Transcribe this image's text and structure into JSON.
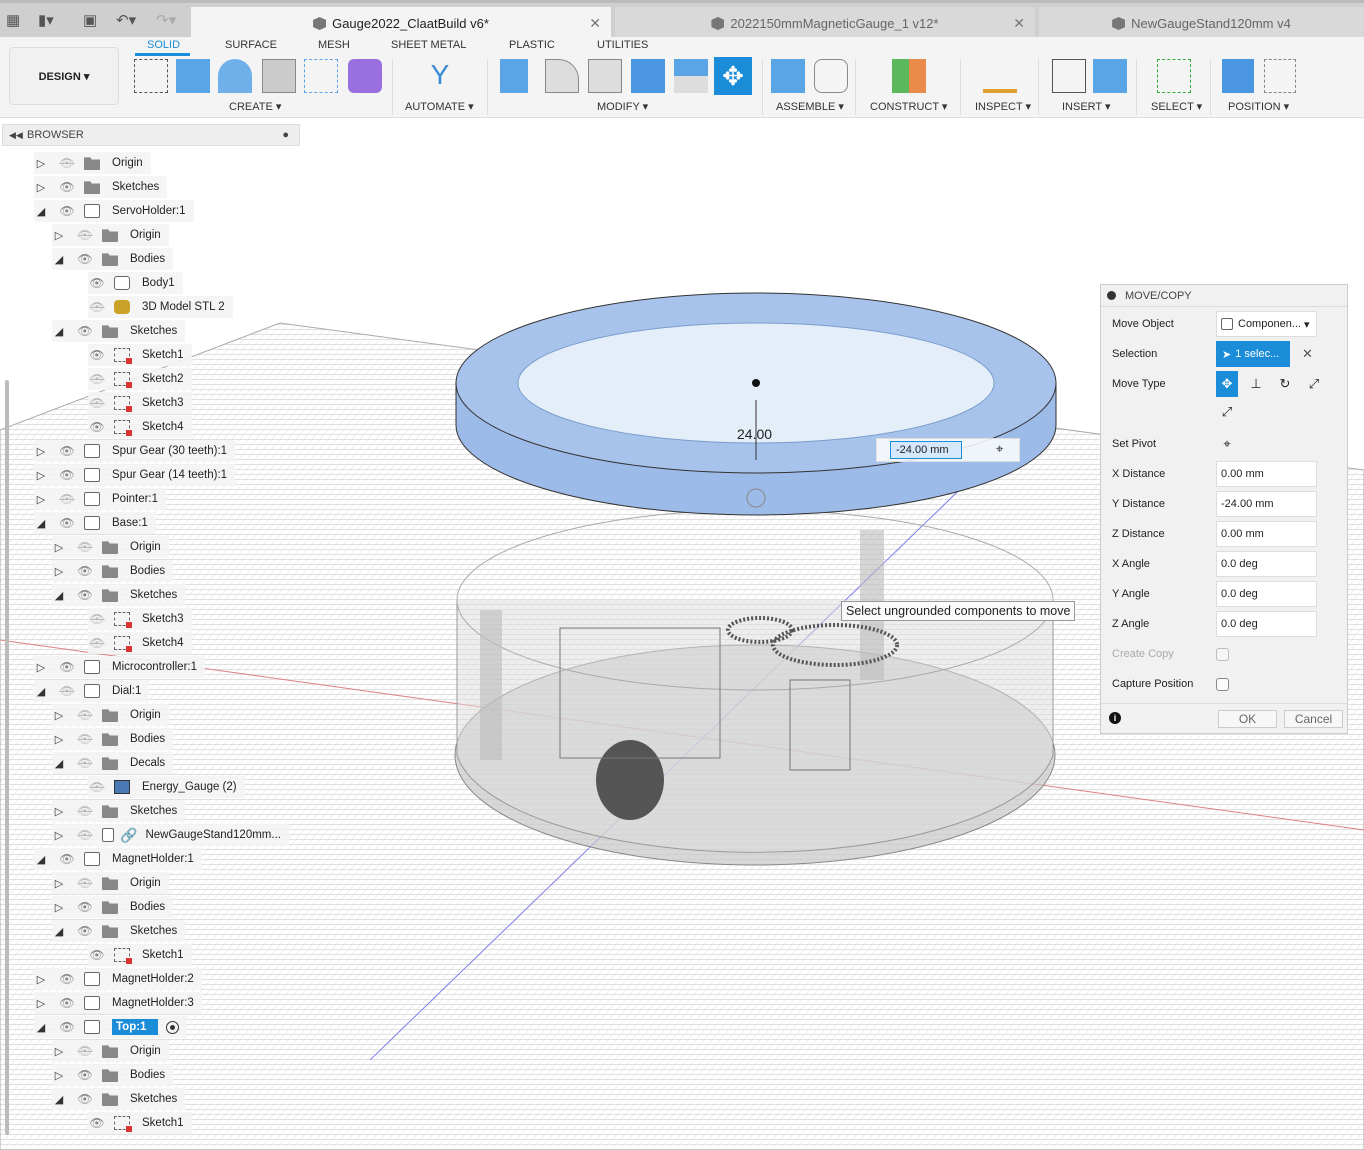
{
  "tabs": [
    {
      "title": "Gauge2022_ClaatBuild v6*",
      "active": true
    },
    {
      "title": "2022150mmMagneticGauge_1 v12*",
      "active": false
    },
    {
      "title": "NewGaugeStand120mm v4",
      "active": false
    }
  ],
  "toolbar_icons": [
    "grid-icon",
    "file-icon",
    "save-icon",
    "undo-icon",
    "redo-icon"
  ],
  "ribbon": {
    "workspace": "DESIGN ▾",
    "tabs": [
      "SOLID",
      "SURFACE",
      "MESH",
      "SHEET METAL",
      "PLASTIC",
      "UTILITIES"
    ],
    "active_tab": "SOLID",
    "groups": [
      "CREATE ▾",
      "AUTOMATE ▾",
      "MODIFY ▾",
      "ASSEMBLE ▾",
      "CONSTRUCT ▾",
      "INSPECT ▾",
      "INSERT ▾",
      "SELECT ▾",
      "POSITION ▾"
    ]
  },
  "browser": {
    "title": "BROWSER",
    "items": [
      {
        "label": "Origin",
        "level": 0,
        "state": "collapsed",
        "visible": false,
        "icon": "folder"
      },
      {
        "label": "Sketches",
        "level": 0,
        "state": "collapsed",
        "visible": true,
        "icon": "folder"
      },
      {
        "label": "ServoHolder:1",
        "level": 0,
        "state": "expanded",
        "visible": true,
        "icon": "component"
      },
      {
        "label": "Origin",
        "level": 1,
        "state": "collapsed",
        "visible": false,
        "icon": "folder"
      },
      {
        "label": "Bodies",
        "level": 1,
        "state": "expanded",
        "visible": true,
        "icon": "folder"
      },
      {
        "label": "Body1",
        "level": 2,
        "state": "none",
        "visible": true,
        "icon": "body"
      },
      {
        "label": "3D Model STL 2",
        "level": 2,
        "state": "none",
        "visible": false,
        "icon": "mesh"
      },
      {
        "label": "Sketches",
        "level": 1,
        "state": "expanded",
        "visible": true,
        "icon": "folder"
      },
      {
        "label": "Sketch1",
        "level": 2,
        "state": "none",
        "visible": true,
        "icon": "sketch"
      },
      {
        "label": "Sketch2",
        "level": 2,
        "state": "none",
        "visible": false,
        "icon": "sketch"
      },
      {
        "label": "Sketch3",
        "level": 2,
        "state": "none",
        "visible": false,
        "icon": "sketch"
      },
      {
        "label": "Sketch4",
        "level": 2,
        "state": "none",
        "visible": true,
        "icon": "sketch"
      },
      {
        "label": "Spur Gear (30 teeth):1",
        "level": 0,
        "state": "collapsed",
        "visible": true,
        "icon": "component"
      },
      {
        "label": "Spur Gear (14 teeth):1",
        "level": 0,
        "state": "collapsed",
        "visible": true,
        "icon": "component"
      },
      {
        "label": "Pointer:1",
        "level": 0,
        "state": "collapsed",
        "visible": false,
        "icon": "component"
      },
      {
        "label": "Base:1",
        "level": 0,
        "state": "expanded",
        "visible": true,
        "icon": "component"
      },
      {
        "label": "Origin",
        "level": 1,
        "state": "collapsed",
        "visible": false,
        "icon": "folder"
      },
      {
        "label": "Bodies",
        "level": 1,
        "state": "collapsed",
        "visible": true,
        "icon": "folder"
      },
      {
        "label": "Sketches",
        "level": 1,
        "state": "expanded",
        "visible": true,
        "icon": "folder"
      },
      {
        "label": "Sketch3",
        "level": 2,
        "state": "none",
        "visible": false,
        "icon": "sketch"
      },
      {
        "label": "Sketch4",
        "level": 2,
        "state": "none",
        "visible": false,
        "icon": "sketch"
      },
      {
        "label": "Microcontroller:1",
        "level": 0,
        "state": "collapsed",
        "visible": true,
        "icon": "component"
      },
      {
        "label": "Dial:1",
        "level": 0,
        "state": "expanded",
        "visible": false,
        "icon": "component"
      },
      {
        "label": "Origin",
        "level": 1,
        "state": "collapsed",
        "visible": false,
        "icon": "folder"
      },
      {
        "label": "Bodies",
        "level": 1,
        "state": "collapsed",
        "visible": false,
        "icon": "folder"
      },
      {
        "label": "Decals",
        "level": 1,
        "state": "expanded",
        "visible": false,
        "icon": "folder"
      },
      {
        "label": "Energy_Gauge (2)",
        "level": 2,
        "state": "none",
        "visible": false,
        "icon": "decal"
      },
      {
        "label": "Sketches",
        "level": 1,
        "state": "collapsed",
        "visible": false,
        "icon": "folder"
      },
      {
        "label": "NewGaugeStand120mm...",
        "level": 1,
        "state": "collapsed",
        "visible": false,
        "icon": "link"
      },
      {
        "label": "MagnetHolder:1",
        "level": 0,
        "state": "expanded",
        "visible": true,
        "icon": "component"
      },
      {
        "label": "Origin",
        "level": 1,
        "state": "collapsed",
        "visible": false,
        "icon": "folder"
      },
      {
        "label": "Bodies",
        "level": 1,
        "state": "collapsed",
        "visible": true,
        "icon": "folder"
      },
      {
        "label": "Sketches",
        "level": 1,
        "state": "expanded",
        "visible": true,
        "icon": "folder"
      },
      {
        "label": "Sketch1",
        "level": 2,
        "state": "none",
        "visible": true,
        "icon": "sketch"
      },
      {
        "label": "MagnetHolder:2",
        "level": 0,
        "state": "collapsed",
        "visible": true,
        "icon": "component"
      },
      {
        "label": "MagnetHolder:3",
        "level": 0,
        "state": "collapsed",
        "visible": true,
        "icon": "component"
      },
      {
        "label": "Top:1",
        "level": 0,
        "state": "expanded",
        "visible": true,
        "icon": "component",
        "selected": true
      },
      {
        "label": "Origin",
        "level": 1,
        "state": "collapsed",
        "visible": false,
        "icon": "folder"
      },
      {
        "label": "Bodies",
        "level": 1,
        "state": "collapsed",
        "visible": true,
        "icon": "folder"
      },
      {
        "label": "Sketches",
        "level": 1,
        "state": "expanded",
        "visible": true,
        "icon": "folder"
      },
      {
        "label": "Sketch1",
        "level": 2,
        "state": "none",
        "visible": true,
        "icon": "sketch"
      }
    ]
  },
  "viewport": {
    "dimension_label": "24.00",
    "dimension_input": "-24.00 mm",
    "tooltip": "Select ungrounded components to move"
  },
  "move_copy": {
    "title": "MOVE/COPY",
    "move_object_label": "Move Object",
    "move_object_value": "Componen...",
    "selection_label": "Selection",
    "selection_value": "1 selec...",
    "move_type_label": "Move Type",
    "set_pivot_label": "Set Pivot",
    "fields": [
      {
        "label": "X Distance",
        "value": "0.00 mm"
      },
      {
        "label": "Y Distance",
        "value": "-24.00 mm"
      },
      {
        "label": "Z Distance",
        "value": "0.00 mm"
      },
      {
        "label": "X Angle",
        "value": "0.0 deg"
      },
      {
        "label": "Y Angle",
        "value": "0.0 deg"
      },
      {
        "label": "Z Angle",
        "value": "0.0 deg"
      }
    ],
    "create_copy_label": "Create Copy",
    "create_copy_checked": false,
    "capture_position_label": "Capture Position",
    "capture_position_checked": false,
    "ok": "OK",
    "cancel": "Cancel"
  },
  "colors": {
    "accent": "#1a8cd8",
    "ring": "#8fb3e6"
  }
}
